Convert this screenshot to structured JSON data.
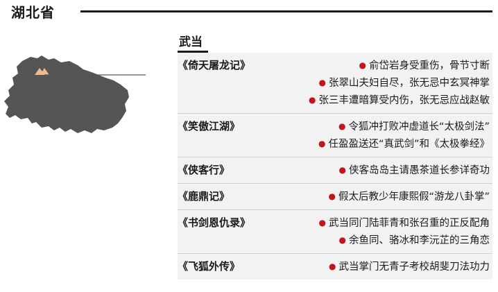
{
  "province": "湖北省",
  "section": "武当",
  "colors": {
    "bullet": "#c0161c",
    "map_fill": "#555555",
    "marker": "#f2b98c",
    "row_bg": "#f2f2f2"
  },
  "books": [
    {
      "title": "《倚天屠龙记》",
      "events": [
        "俞岱岩身受重伤，骨节寸断",
        "张翠山夫妇自尽，张无忌中玄冥神掌",
        "张三丰遭暗算受内伤，张无忌应战赵敏"
      ]
    },
    {
      "title": "《笑傲江湖》",
      "events": [
        "令狐冲打败冲虚道长“太极剑法”",
        "任盈盈送还“真武剑”和《太极拳经》"
      ]
    },
    {
      "title": "《侠客行》",
      "events": [
        "侠客岛岛主请愚茶道长参详奇功"
      ]
    },
    {
      "title": "《鹿鼎记》",
      "events": [
        "假太后教少年康熙假“游龙八卦掌”"
      ]
    },
    {
      "title": "《书剑恩仇录》",
      "events": [
        "武当同门陆菲青和张召重的正反配角",
        "余鱼同、骆冰和李沅芷的三角恋"
      ]
    },
    {
      "title": "《飞狐外传》",
      "events": [
        "武当掌门无青子考校胡斐刀法功力"
      ]
    }
  ]
}
